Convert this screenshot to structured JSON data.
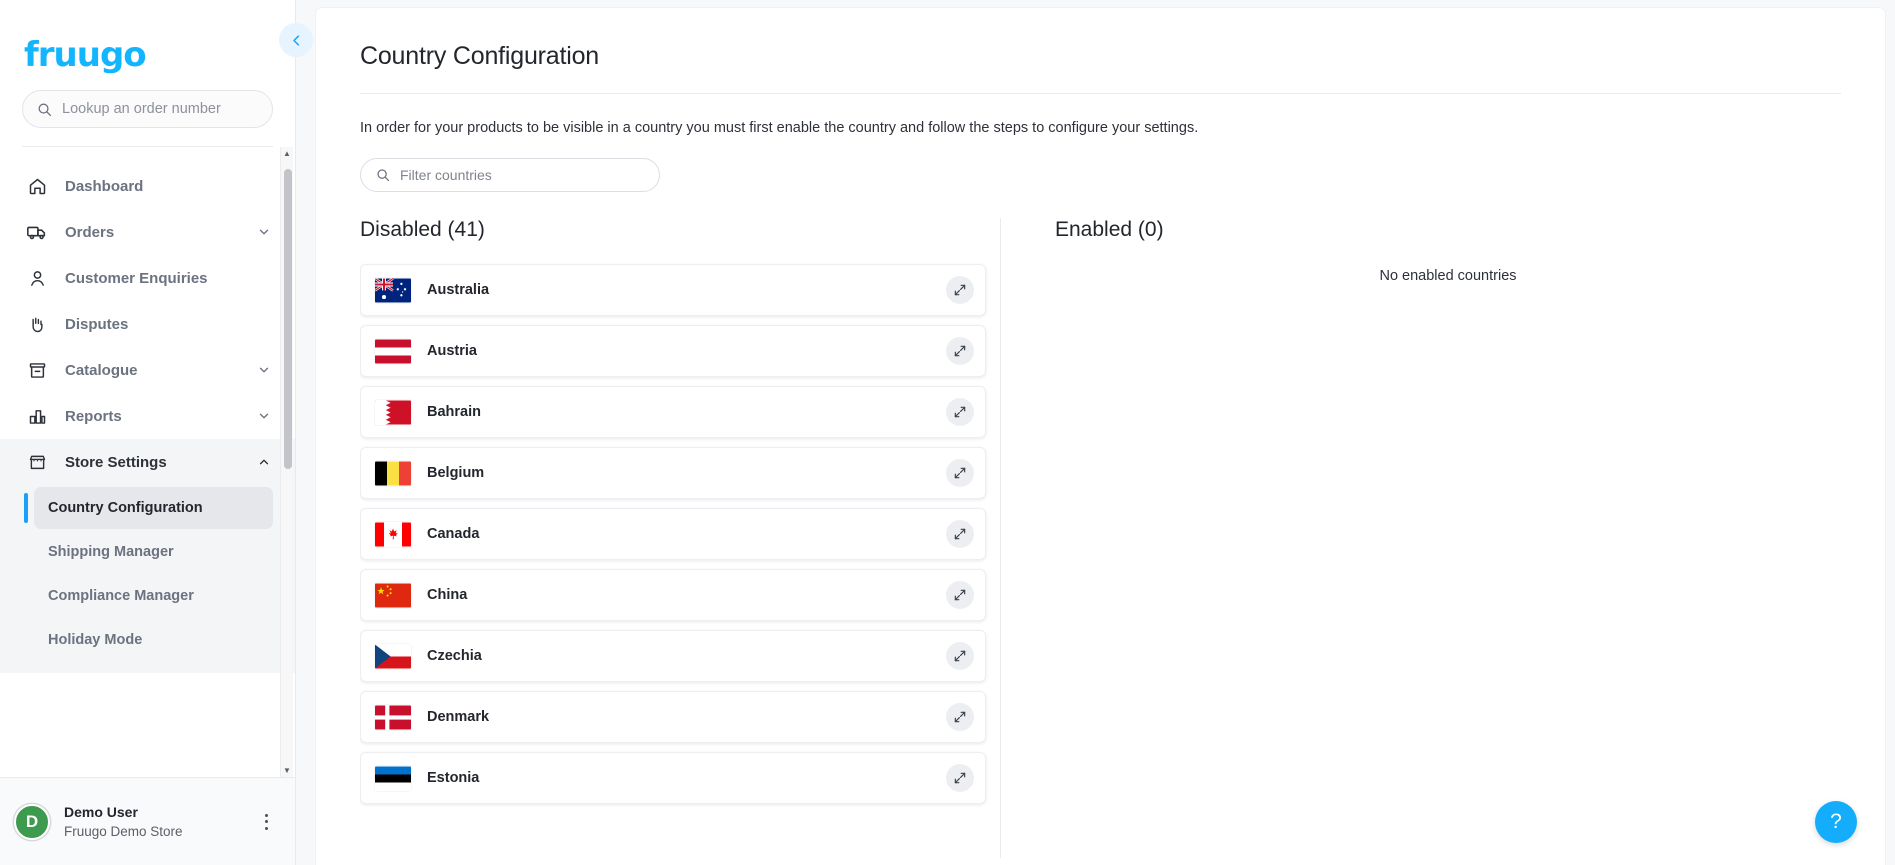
{
  "brand": {
    "logo_text": "fruugo",
    "logo_color": "#13b5ff"
  },
  "sidebar": {
    "order_search_placeholder": "Lookup an order number",
    "nav": [
      {
        "label": "Dashboard",
        "icon": "home-icon",
        "expandable": false
      },
      {
        "label": "Orders",
        "icon": "truck-icon",
        "expandable": true
      },
      {
        "label": "Customer Enquiries",
        "icon": "person-icon",
        "expandable": false
      },
      {
        "label": "Disputes",
        "icon": "hand-icon",
        "expandable": false
      },
      {
        "label": "Catalogue",
        "icon": "box-icon",
        "expandable": true
      },
      {
        "label": "Reports",
        "icon": "bar-chart-icon",
        "expandable": true
      },
      {
        "label": "Store Settings",
        "icon": "store-icon",
        "expandable": true,
        "expanded": true
      }
    ],
    "store_settings_children": [
      {
        "label": "Country Configuration",
        "active": true
      },
      {
        "label": "Shipping Manager",
        "active": false
      },
      {
        "label": "Compliance Manager",
        "active": false
      },
      {
        "label": "Holiday Mode",
        "active": false
      }
    ],
    "user": {
      "avatar_initial": "D",
      "avatar_color": "#3d9a4e",
      "name": "Demo User",
      "store": "Fruugo Demo Store"
    }
  },
  "main": {
    "title": "Country Configuration",
    "intro": "In order for your products to be visible in a country you must first enable the country and follow the steps to configure your settings.",
    "filter_placeholder": "Filter countries",
    "disabled_title": "Disabled (41)",
    "enabled_title": "Enabled (0)",
    "enabled_empty": "No enabled countries",
    "disabled_count": 41,
    "enabled_count": 0,
    "countries_disabled": [
      {
        "name": "Australia",
        "code": "AU"
      },
      {
        "name": "Austria",
        "code": "AT"
      },
      {
        "name": "Bahrain",
        "code": "BH"
      },
      {
        "name": "Belgium",
        "code": "BE"
      },
      {
        "name": "Canada",
        "code": "CA"
      },
      {
        "name": "China",
        "code": "CN"
      },
      {
        "name": "Czechia",
        "code": "CZ"
      },
      {
        "name": "Denmark",
        "code": "DK"
      },
      {
        "name": "Estonia",
        "code": "EE"
      }
    ]
  },
  "help": {
    "label": "?"
  },
  "colors": {
    "accent": "#18a0fb",
    "help_bg": "#14adfb",
    "active_bg": "#e6e7ea"
  }
}
